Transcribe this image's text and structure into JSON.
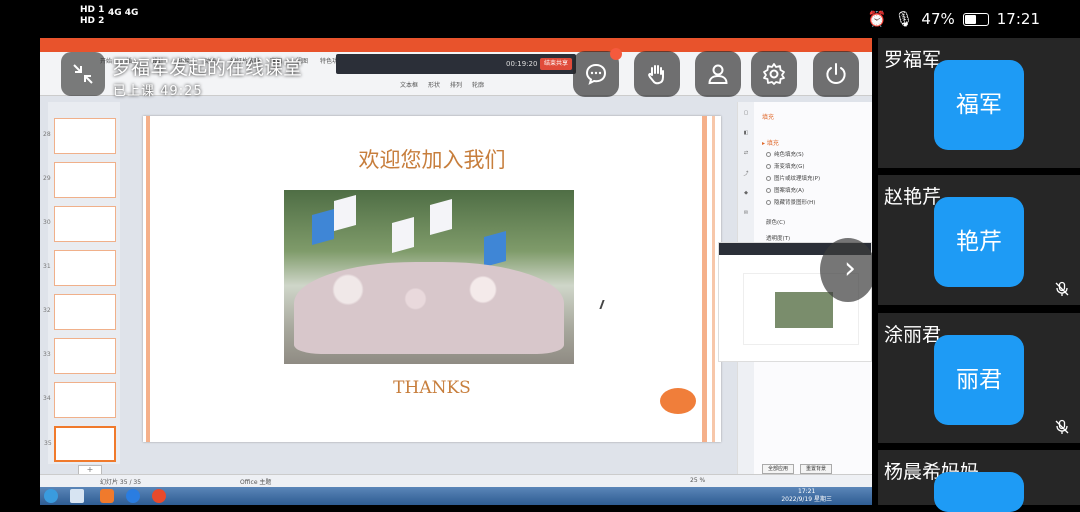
{
  "status_bar": {
    "sim1": "HD 1",
    "sim2": "HD 2",
    "signal": "4G 4G",
    "battery": "47%",
    "time": "17:21"
  },
  "classroom": {
    "title": "罗福军发起的在线课堂",
    "elapsed_label": "已上课",
    "elapsed": "49:25"
  },
  "toolbar": {
    "icons": [
      "chat-icon",
      "raise-hand-icon",
      "person-icon",
      "gear-icon",
      "power-icon"
    ]
  },
  "presentation": {
    "slide_title": "欢迎您加入我们",
    "slide_footer": "THANKS",
    "accent_color": "#c77e3c",
    "record_time": "00:19:20",
    "record_end": "结束共享",
    "ribbon_tabs": [
      "开始",
      "插入",
      "设计",
      "切换",
      "动画",
      "幻灯片放映",
      "审阅",
      "视图",
      "特色功能"
    ],
    "ribbon_tools": [
      "文本框",
      "形状",
      "排列",
      "轮廓"
    ],
    "thumb_numbers": [
      "28",
      "29",
      "30",
      "31",
      "32",
      "33",
      "34",
      "35"
    ],
    "status_left": "幻灯片 35 / 35",
    "status_mid": "Office 主题",
    "zoom": "25 %",
    "pane_tab": "填充",
    "pane_head": "▸ 填充",
    "pane_options": [
      "纯色填充(S)",
      "渐变填充(G)",
      "图片或纹理填充(P)",
      "图案填充(A)",
      "隐藏背景图形(H)"
    ],
    "pane_labels": [
      "颜色(C)",
      "透明度(T)"
    ],
    "pane_buttons": [
      "全部应用",
      "重置背景"
    ],
    "taskbar_time": "17:21",
    "taskbar_date": "2022/9/19 星期三"
  },
  "participants": [
    {
      "name": "罗福军",
      "avatar": "福军",
      "muted": false
    },
    {
      "name": "赵艳芹",
      "avatar": "艳芹",
      "muted": true
    },
    {
      "name": "涂丽君",
      "avatar": "丽君",
      "muted": true
    },
    {
      "name": "杨晨希妈妈",
      "avatar": "",
      "muted": false
    }
  ],
  "colors": {
    "avatar_bg": "#1e9bf5",
    "tile_bg": "#262626",
    "badge": "#f55a3d"
  }
}
